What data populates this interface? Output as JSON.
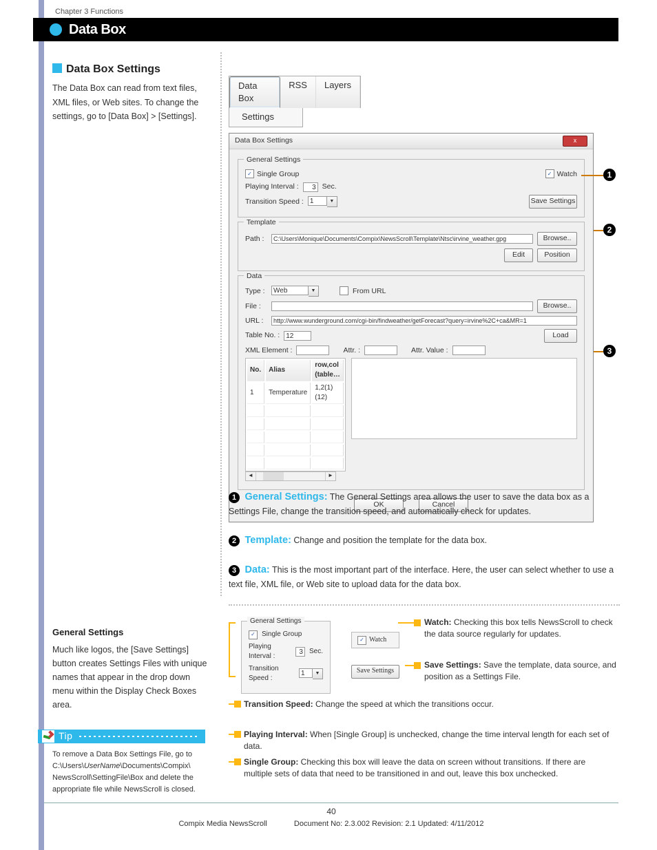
{
  "chapter": "Chapter 3 Functions",
  "page_title": "Data Box",
  "subtitle": "Data Box Settings",
  "intro_text": "The Data Box can read from text files, XML files, or Web sites. To change the settings, go to [Data Box] > [Settings].",
  "tabs": {
    "databox": "Data Box",
    "rss": "RSS",
    "layers": "Layers",
    "settings": "Settings"
  },
  "dialog": {
    "title": "Data Box Settings",
    "close": "x",
    "general": {
      "legend": "General Settings",
      "single_group": "Single Group",
      "watch": "Watch",
      "playing_interval_label": "Playing Interval :",
      "playing_interval_value": "3",
      "sec": "Sec.",
      "transition_speed_label": "Transition Speed :",
      "transition_speed_value": "1",
      "save_settings": "Save Settings"
    },
    "template": {
      "legend": "Template",
      "path_label": "Path :",
      "path_value": "C:\\Users\\Monique\\Documents\\Compix\\NewsScroll\\Template\\Ntsc\\irvine_weather.gpg",
      "browse": "Browse..",
      "edit": "Edit",
      "position": "Position"
    },
    "data": {
      "legend": "Data",
      "type_label": "Type :",
      "type_value": "Web",
      "from_url": "From URL",
      "file_label": "File :",
      "browse": "Browse..",
      "url_label": "URL :",
      "url_value": "http://www.wunderground.com/cgi-bin/findweather/getForecast?query=irvine%2C+ca&MR=1",
      "tableno_label": "Table No. :",
      "tableno_value": "12",
      "load": "Load",
      "xmlel_label": "XML Element :",
      "attr_label": "Attr. :",
      "attrval_label": "Attr. Value :",
      "th_no": "No.",
      "th_alias": "Alias",
      "th_rowcol": "row,col (table…",
      "td_no": "1",
      "td_alias": "Temperature",
      "td_rowcol": "1,2(1) (12)"
    },
    "ok": "OK",
    "cancel": "Cancel"
  },
  "descriptions": {
    "n1_head": "General Settings:",
    "n1_body": " The General Settings area allows the user to save the data box as a Settings File, change the transition speed, and automatically check for updates.",
    "n2_head": "Template:",
    "n2_body": " Change and position the template for the data box.",
    "n3_head": "Data:",
    "n3_body": " This is the most important part of the interface. Here, the user can select whether to use a text file, XML file, or Web site to upload data for the data box."
  },
  "general_settings_para": {
    "head": "General Settings",
    "body": "Much like logos, the [Save Settings] button creates Settings Files with unique names that appear in the drop down menu within the Display Check Boxes area."
  },
  "tip": {
    "label": "Tip",
    "body_1": "To remove a Data Box Settings File, go to C:\\Users\\",
    "body_italic": "UserName",
    "body_2": "\\Documents\\Compix\\ NewsScroll\\SettingFile\\Box and delete the appropriate file while NewsScroll is closed."
  },
  "mini": {
    "legend": "General Settings",
    "single_group": "Single Group",
    "playing_interval": "Playing Interval :",
    "pi_value": "3",
    "sec": "Sec.",
    "transition_speed": "Transition Speed :",
    "ts_value": "1",
    "watch": "Watch",
    "save": "Save Settings"
  },
  "details": {
    "watch": "Watch:",
    "watch_b": " Checking this box tells NewsScroll to check the data source regularly for updates.",
    "save": "Save Settings:",
    "save_b": " Save the template, data source, and position as a Settings File.",
    "tspeed": "Transition Speed:",
    "tspeed_b": " Change the speed at which the transitions occur.",
    "pint": "Playing Interval:",
    "pint_b": " When [Single Group] is unchecked, change the time interval length for each set of data.",
    "sgrp": "Single Group:",
    "sgrp_b": " Checking this box will leave the data on screen without transitions. If there are multiple sets of data that need to be transitioned in and out, leave this box unchecked."
  },
  "footer": {
    "page": "40",
    "product": "Compix Media NewsScroll",
    "docinfo": "Document No: 2.3.002 Revision: 2.1 Updated: 4/11/2012"
  },
  "callouts": {
    "n1": "1",
    "n2": "2",
    "n3": "3"
  }
}
